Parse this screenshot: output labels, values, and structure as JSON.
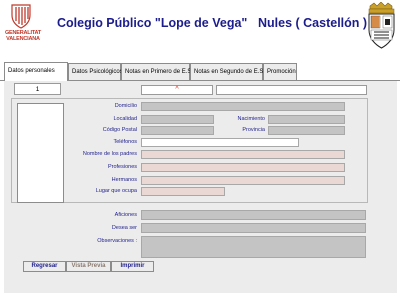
{
  "header": {
    "logo_text": "GENERALITAT\nVALENCIANA",
    "school": "Colegio Público \"Lope de Vega\"",
    "city": "Nules ( Castellón )"
  },
  "tabs": [
    {
      "label": "Datos personales",
      "active": true
    },
    {
      "label": "Datos Psicológicos",
      "active": false
    },
    {
      "label": "Notas en Primero de E.S.O.",
      "active": false
    },
    {
      "label": "Notas en Segundo de E.S.O.",
      "active": false
    },
    {
      "label": "Promoción",
      "active": false
    }
  ],
  "record": {
    "counter": "1",
    "field1_value": "^"
  },
  "fields": {
    "domicilio": "Domicilio",
    "localidad": "Localidad",
    "nacimiento": "Nacimiento",
    "codigo_postal": "Código Postal",
    "provincia": "Provincia",
    "telefonos": "Teléfonos",
    "nombre_padres": "Nombre de los padres",
    "profesiones": "Profesiones",
    "hermanos": "Hermanos",
    "lugar": "Lugar que ocupa",
    "aficiones": "Aficiones",
    "desea_ser": "Desea ser",
    "observaciones": "Observaciones :"
  },
  "buttons": {
    "regresar": "Regresar",
    "vista_previa": "Vista Previa",
    "imprimir": "Imprimir"
  },
  "colors": {
    "title": "#1c1c8c",
    "label": "#1e1e8c",
    "logo": "#c0392b",
    "vista_previa": "#8a7a70"
  }
}
